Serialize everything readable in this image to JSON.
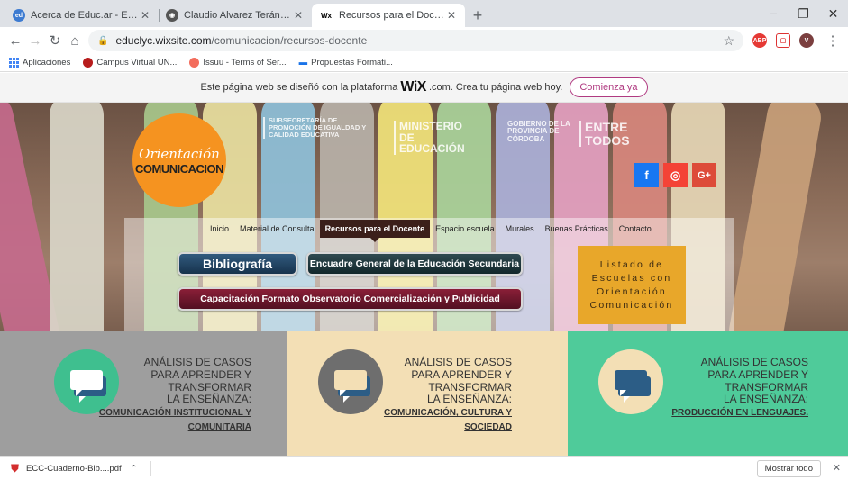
{
  "browser": {
    "tabs": [
      {
        "title": "Acerca de Educ.ar - Educ.ar",
        "close": "✕"
      },
      {
        "title": "Claudio Alvarez Terán « Palimpsesto",
        "close": "✕"
      },
      {
        "title": "Recursos para el Docente | comunicacion",
        "close": "✕"
      }
    ],
    "new_tab": "+",
    "window_controls": {
      "minimize": "−",
      "maximize": "❐",
      "close": "✕"
    },
    "address": {
      "domain": "educlyc.wixsite.com",
      "path": "/comunicacion/recursos-docente"
    },
    "bookmarks": [
      "Aplicaciones",
      "Campus Virtual UN...",
      "Issuu - Terms of Ser...",
      "Propuestas Formati..."
    ],
    "profile_initial": "V"
  },
  "wix_banner": {
    "text_before": "Este página web se diseñó con la plataforma",
    "logo": "WiX",
    "text_after": ".com. Crea tu página web hoy.",
    "cta": "Comienza ya"
  },
  "hero": {
    "logo_line1": "Orientación",
    "logo_line2": "COMUNICACION",
    "gov1": "Subsecretaría de Promoción de Igualdad y Calidad Educativa",
    "gov2": "Ministerio de Educación",
    "gov3": "Gobierno de la Provincia de Córdoba",
    "gov4": "Entre Todos",
    "social": {
      "facebook": "f",
      "instagram": "◎",
      "google": "G+"
    },
    "menu": [
      "Inicio",
      "Material de Consulta",
      "Recursos para el Docente",
      "Espacio escuela",
      "Murales",
      "Buenas Prácticas",
      "Contacto"
    ],
    "active_menu": "Recursos para el Docente",
    "buttons": {
      "bibliografia": "Bibliografía",
      "encuadre": "Encuadre General de la Educación Secundaria",
      "capacitacion": "Capacitación Formato Observatorio Comercialización y Publicidad"
    },
    "listado": [
      "Listado de",
      "Escuelas con",
      "Orientación",
      "Comunicación"
    ]
  },
  "columns": [
    {
      "lines": [
        "Análisis de casos",
        "para aprender y",
        "transformar",
        "la enseñanza:"
      ],
      "link": [
        "Comunicación Institucional y",
        "Comunitaria"
      ],
      "bg": "#9e9e9e",
      "icon_bg": "#3fbf8f"
    },
    {
      "lines": [
        "Análisis de casos",
        "para aprender y",
        "transformar",
        "la enseñanza:"
      ],
      "link": [
        "Comunicación, Cultura y",
        "Sociedad"
      ],
      "bg": "#f3dfb5",
      "icon_bg": "#6e6e6e"
    },
    {
      "lines": [
        "Análisis de casos",
        "para aprender y",
        "transformar",
        "la enseñanza:"
      ],
      "link": [
        "Producción en Lenguajes."
      ],
      "bg": "#4fcb9a",
      "icon_bg": "#f3dfb5"
    }
  ],
  "downloads": {
    "file": "ECC-Cuaderno-Bib....pdf",
    "show_all": "Mostrar todo"
  },
  "colors": {
    "accent_orange": "#f59320",
    "wix_pink": "#b03a81"
  }
}
